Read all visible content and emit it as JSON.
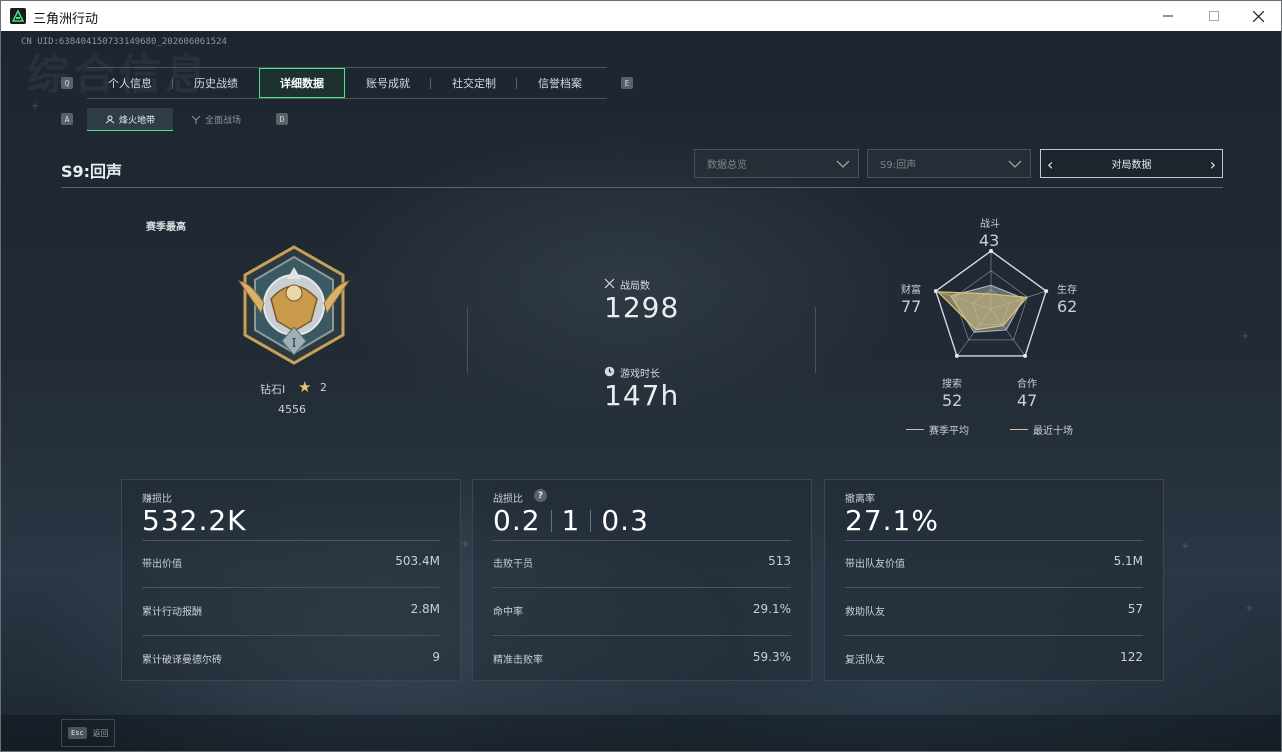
{
  "window": {
    "title": "三角洲行动"
  },
  "header": {
    "uid": "CN UID:6384041507331496​80_202606061524",
    "bg_title": "综合信息"
  },
  "keys": {
    "prev_tab": "Q",
    "next_tab": "E",
    "prev_sub": "A",
    "next_sub": "D"
  },
  "tabs": [
    {
      "label": "个人信息"
    },
    {
      "label": "历史战绩"
    },
    {
      "label": "详细数据"
    },
    {
      "label": "账号成就"
    },
    {
      "label": "社交定制"
    },
    {
      "label": "信誉档案"
    }
  ],
  "subtabs": [
    {
      "label": "烽火地带"
    },
    {
      "label": "全面战场"
    }
  ],
  "season": {
    "title": "S9:回声"
  },
  "filters": {
    "data_type": "数据总览",
    "season": "S9:回声",
    "mode": "对局数据"
  },
  "rank": {
    "label": "赛季最高",
    "name": "钻石I",
    "stars": "2",
    "score": "4556"
  },
  "stats": {
    "matches_label": "战局数",
    "matches_value": "1298",
    "playtime_label": "游戏时长",
    "playtime_value": "147h"
  },
  "radar": {
    "axes": [
      {
        "label": "战斗",
        "value": "43"
      },
      {
        "label": "生存",
        "value": "62"
      },
      {
        "label": "合作",
        "value": "47"
      },
      {
        "label": "搜索",
        "value": "52"
      },
      {
        "label": "财富",
        "value": "77"
      }
    ],
    "legend_avg": "赛季平均",
    "legend_recent": "最近十场",
    "colors": {
      "avg": "#b9bfc4",
      "recent": "#d8c47a"
    }
  },
  "cards": {
    "profit": {
      "label": "赚损比",
      "value": "532.2K",
      "rows": [
        {
          "k": "带出价值",
          "v": "503.4M"
        },
        {
          "k": "累计行动报酬",
          "v": "2.8M"
        },
        {
          "k": "累计破译曼德尔砖",
          "v": "9"
        }
      ]
    },
    "combat": {
      "label": "战损比",
      "help": "?",
      "values": [
        "0.2",
        "1",
        "0.3"
      ],
      "rows": [
        {
          "k": "击败干员",
          "v": "513"
        },
        {
          "k": "命中率",
          "v": "29.1%"
        },
        {
          "k": "精准击败率",
          "v": "59.3%"
        }
      ]
    },
    "extract": {
      "label": "撤离率",
      "value": "27.1%",
      "rows": [
        {
          "k": "带出队友价值",
          "v": "5.1M"
        },
        {
          "k": "救助队友",
          "v": "57"
        },
        {
          "k": "复活队友",
          "v": "122"
        }
      ]
    }
  },
  "footer": {
    "esc_key": "Esc",
    "esc_label": "返回"
  }
}
